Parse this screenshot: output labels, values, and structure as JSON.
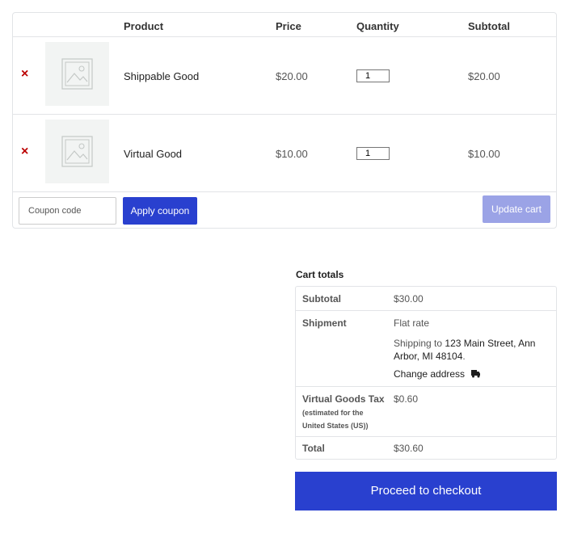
{
  "cart": {
    "headers": {
      "product": "Product",
      "price": "Price",
      "quantity": "Quantity",
      "subtotal": "Subtotal"
    },
    "items": [
      {
        "remove_icon": "×",
        "name": "Shippable Good",
        "price": "$20.00",
        "quantity": "1",
        "subtotal": "$20.00"
      },
      {
        "remove_icon": "×",
        "name": "Virtual Good",
        "price": "$10.00",
        "quantity": "1",
        "subtotal": "$10.00"
      }
    ],
    "coupon_placeholder": "Coupon code",
    "apply_label": "Apply coupon",
    "update_label": "Update cart"
  },
  "totals": {
    "title": "Cart totals",
    "subtotal_label": "Subtotal",
    "subtotal_value": "$30.00",
    "shipment_label": "Shipment",
    "shipment_method": "Flat rate",
    "shipping_prefix": "Shipping to ",
    "shipping_address": "123 Main Street, Ann Arbor, MI 48104",
    "shipping_suffix": ".",
    "change_address": "Change address",
    "tax_label": "Virtual Goods Tax",
    "tax_note": "(estimated for the United States (US))",
    "tax_value": "$0.60",
    "total_label": "Total",
    "total_value": "$30.60"
  },
  "checkout_label": "Proceed to checkout",
  "colors": {
    "primary": "#2940cf",
    "primary_disabled": "#9ba3e6",
    "remove": "#bb0000"
  }
}
